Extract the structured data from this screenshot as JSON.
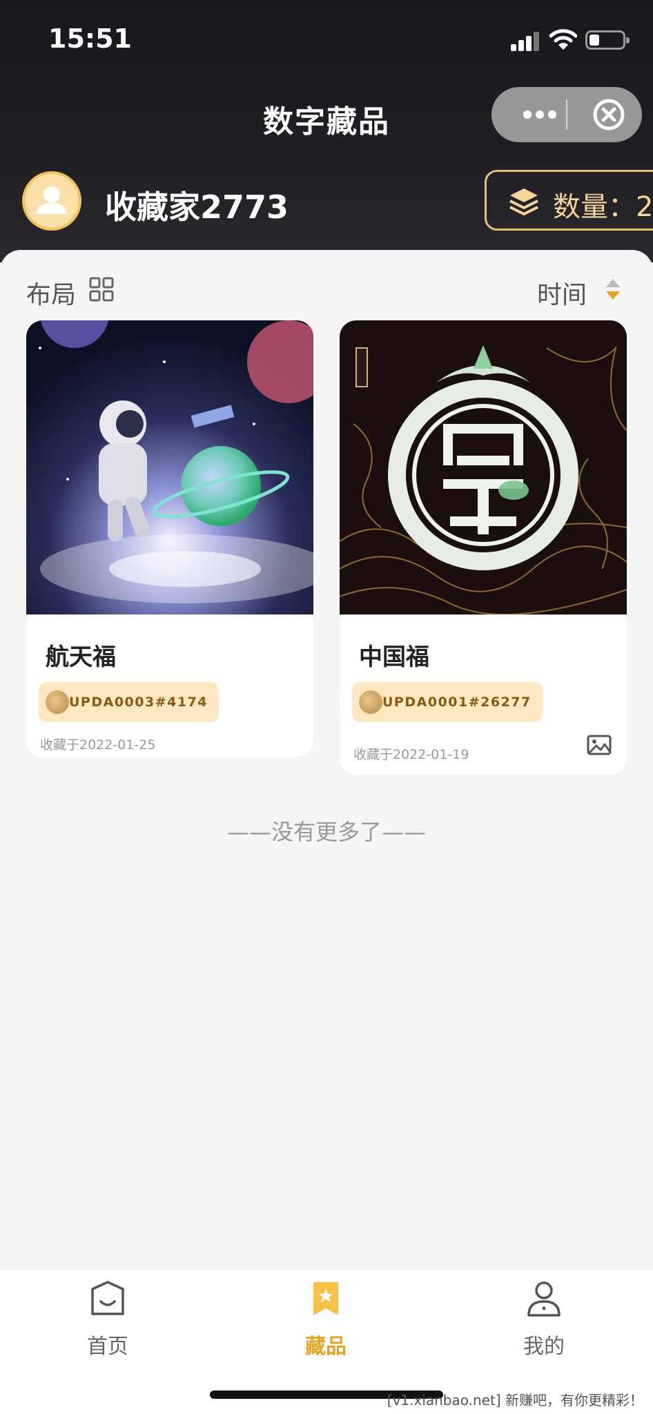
{
  "status_bar": {
    "time": "15:51"
  },
  "nav": {
    "title": "数字藏品"
  },
  "user": {
    "name": "收藏家2773",
    "count_label": "数量：2"
  },
  "toolbar": {
    "layout_label": "布局",
    "sort_label": "时间"
  },
  "items": [
    {
      "name": "航天福",
      "badge": "UPDA0003#4174",
      "date": "收藏于2022-01-25"
    },
    {
      "name": "中国福",
      "badge": "UPDA0001#26277",
      "date": "收藏于2022-01-19"
    }
  ],
  "end_text": "——没有更多了——",
  "tabs": [
    {
      "label": "首页"
    },
    {
      "label": "藏品"
    },
    {
      "label": "我的"
    }
  ],
  "watermark": "[v1.xianbao.net] 新赚吧，有你更精彩！",
  "colors": {
    "accent": "#e9a324",
    "badge_bg": "#fde8c2",
    "header_bg": "#17171d"
  }
}
